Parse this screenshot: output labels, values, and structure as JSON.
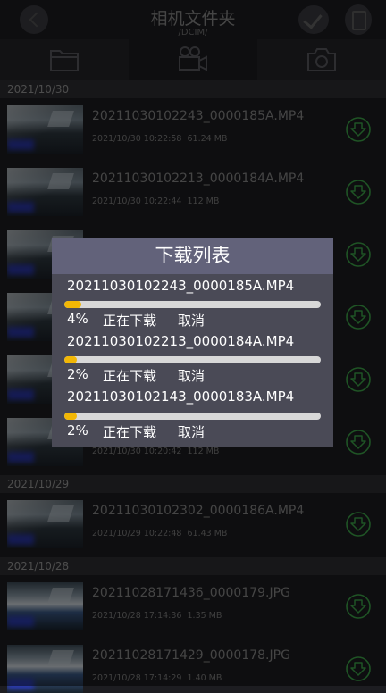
{
  "header": {
    "title": "相机文件夹",
    "subtitle": "/DCIM/"
  },
  "tabs": [
    {
      "name": "folder-icon",
      "active": false
    },
    {
      "name": "video-camera-icon",
      "active": true
    },
    {
      "name": "camera-icon",
      "active": false
    }
  ],
  "sections": [
    {
      "date": "2021/10/30"
    },
    {
      "date": "2021/10/29"
    },
    {
      "date": "2021/10/28"
    }
  ],
  "files": [
    {
      "name": "20211030102243_0000185A.MP4",
      "date": "2021/10/30 10:22:58",
      "size": "61.24 MB"
    },
    {
      "name": "20211030102213_0000184A.MP4",
      "date": "2021/10/30 10:22:44",
      "size": "112 MB"
    },
    {
      "name": "",
      "date": "",
      "size": ""
    },
    {
      "name": "",
      "date": "",
      "size": ""
    },
    {
      "name": "",
      "date": "",
      "size": ""
    },
    {
      "name": "",
      "date": "2021/10/30 10:20:42",
      "size": "112 MB"
    },
    {
      "name": "20211030102302_0000186A.MP4",
      "date": "2021/10/29 10:22:48",
      "size": "61.43 MB"
    },
    {
      "name": "20211028171436_0000179.JPG",
      "date": "2021/10/28 17:14:36",
      "size": "1.35 MB"
    },
    {
      "name": "20211028171429_0000178.JPG",
      "date": "2021/10/28 17:14:29",
      "size": "1.40 MB"
    }
  ],
  "download_dialog": {
    "title": "下载列表",
    "items": [
      {
        "name": "20211030102243_0000185A.MP4",
        "percent": "4%",
        "progress": 4,
        "status": "正在下载",
        "cancel": "取消"
      },
      {
        "name": "20211030102213_0000184A.MP4",
        "percent": "2%",
        "progress": 2,
        "status": "正在下载",
        "cancel": "取消"
      },
      {
        "name": "20211030102143_0000183A.MP4",
        "percent": "2%",
        "progress": 2,
        "status": "正在下载",
        "cancel": "取消"
      }
    ]
  },
  "colors": {
    "accent_green": "#3ea84a",
    "progress_fill": "#f2b705"
  }
}
